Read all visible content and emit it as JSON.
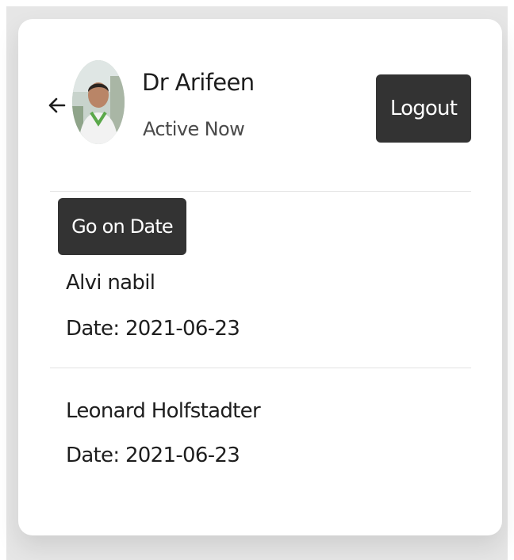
{
  "header": {
    "name": "Dr Arifeen",
    "status": "Active Now",
    "logout_label": "Logout",
    "back_icon": "arrow-left-icon",
    "avatar": "user-avatar"
  },
  "dates": {
    "go_label": "Go on Date",
    "entries": [
      {
        "name": "Alvi nabil",
        "date": "Date: 2021-06-23"
      },
      {
        "name": "Leonard Holfstadter",
        "date": "Date: 2021-06-23"
      }
    ]
  },
  "colors": {
    "button_bg": "#333333",
    "card_bg": "#ffffff",
    "backdrop": "#e6e6e6"
  }
}
